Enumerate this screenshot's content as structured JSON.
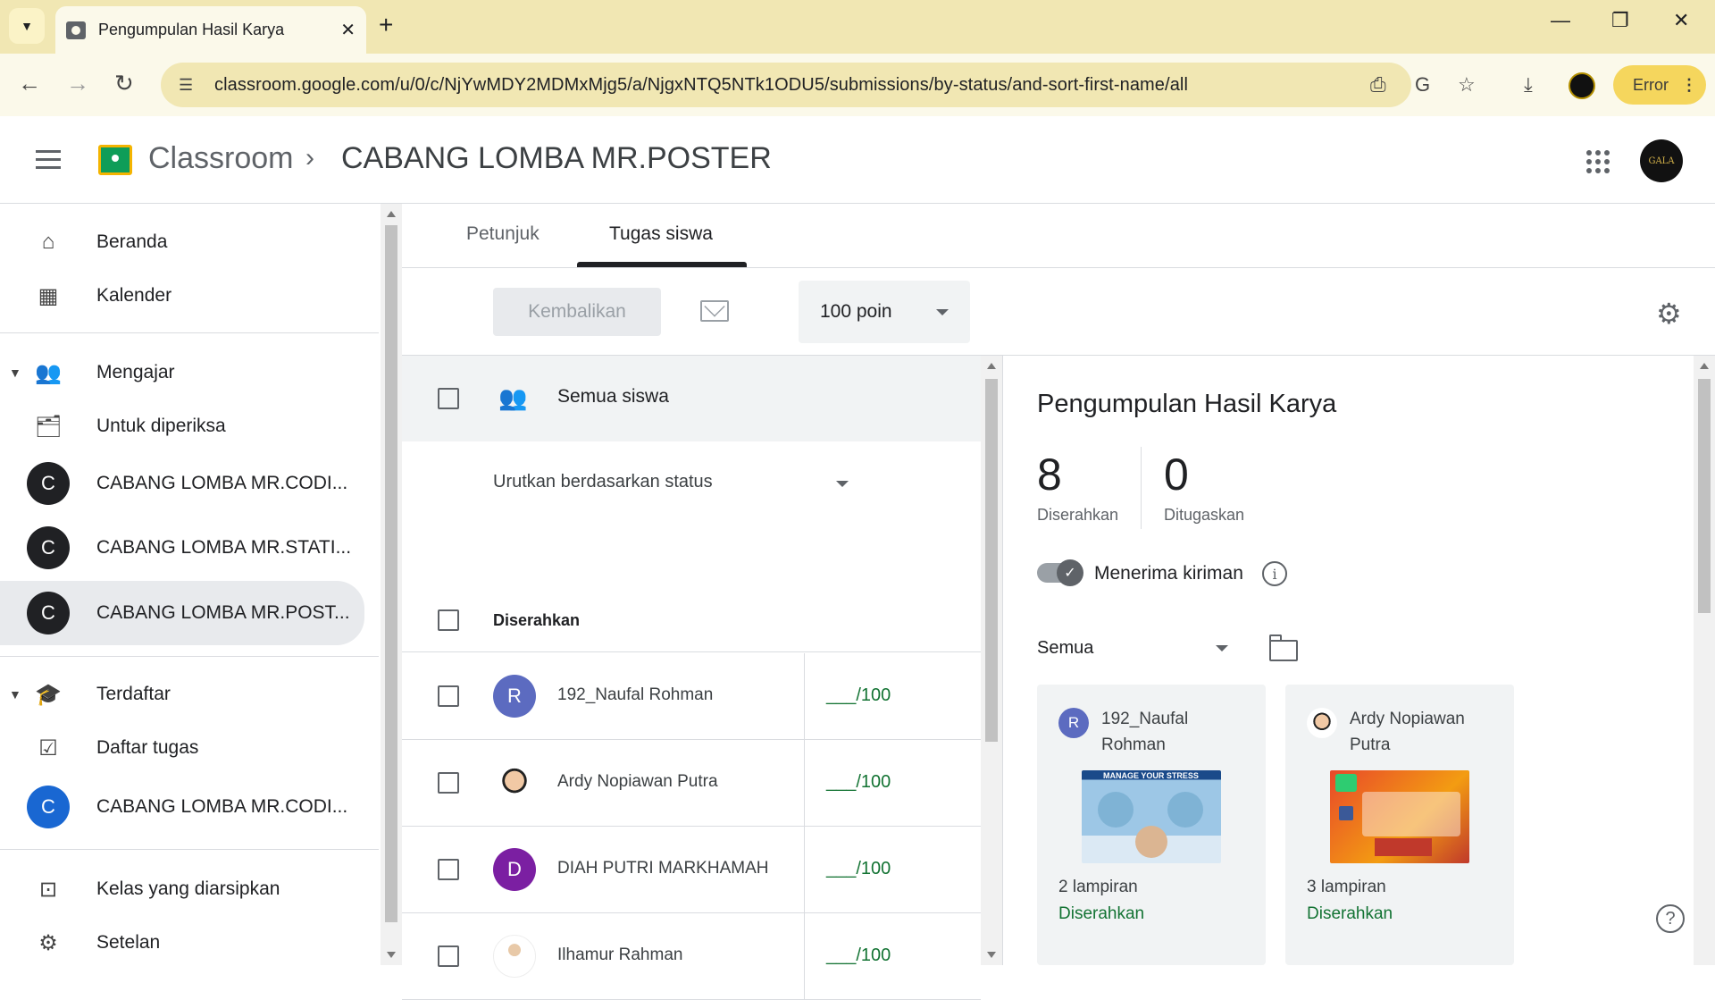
{
  "browser": {
    "tab_title": "Pengumpulan Hasil Karya",
    "url": "classroom.google.com/u/0/c/NjYwMDY2MDMxMjg5/a/NjgxNTQ5NTk1ODU5/submissions/by-status/and-sort-first-name/all",
    "error_label": "Error"
  },
  "header": {
    "brand": "Classroom",
    "breadcrumb": "CABANG LOMBA MR.POSTER",
    "avatar_text": "GALA"
  },
  "sidebar": {
    "home": "Beranda",
    "calendar": "Kalender",
    "teaching": "Mengajar",
    "to_review": "Untuk diperiksa",
    "teaching_classes": [
      {
        "initial": "C",
        "label": "CABANG LOMBA MR.CODI..."
      },
      {
        "initial": "C",
        "label": "CABANG LOMBA MR.STATI..."
      },
      {
        "initial": "C",
        "label": "CABANG LOMBA MR.POST..."
      }
    ],
    "enrolled": "Terdaftar",
    "todo": "Daftar tugas",
    "enrolled_classes": [
      {
        "initial": "C",
        "label": "CABANG LOMBA MR.CODI..."
      }
    ],
    "archived": "Kelas yang diarsipkan",
    "settings": "Setelan"
  },
  "tabs": {
    "instructions": "Petunjuk",
    "student_work": "Tugas siswa"
  },
  "toolbar": {
    "return_label": "Kembalikan",
    "points": "100 poin"
  },
  "list": {
    "all_students": "Semua siswa",
    "sort_label": "Urutkan berdasarkan status",
    "group_label": "Diserahkan",
    "students": [
      {
        "initial": "R",
        "name": "192_Naufal Rohman",
        "score": "___/100",
        "color": "#5c6bc0"
      },
      {
        "initial": "",
        "name": "Ardy Nopiawan Putra",
        "score": "___/100",
        "color": "#e53935"
      },
      {
        "initial": "D",
        "name": "DIAH PUTRI MARKHAMAH",
        "score": "___/100",
        "color": "#7b1fa2"
      },
      {
        "initial": "",
        "name": "Ilhamur Rahman",
        "score": "___/100",
        "color": "#ffffff"
      }
    ]
  },
  "detail": {
    "title": "Pengumpulan Hasil Karya",
    "submitted_count": "8",
    "submitted_label": "Diserahkan",
    "assigned_count": "0",
    "assigned_label": "Ditugaskan",
    "accepting_label": "Menerima kiriman",
    "filter_label": "Semua",
    "cards": [
      {
        "initial": "R",
        "name": "192_Naufal Rohman",
        "image_text": "MANAGE YOUR STRESS",
        "attachments": "2 lampiran",
        "status": "Diserahkan"
      },
      {
        "initial": "",
        "name": "Ardy Nopiawan Putra",
        "attachments": "3 lampiran",
        "status": "Diserahkan"
      }
    ]
  }
}
